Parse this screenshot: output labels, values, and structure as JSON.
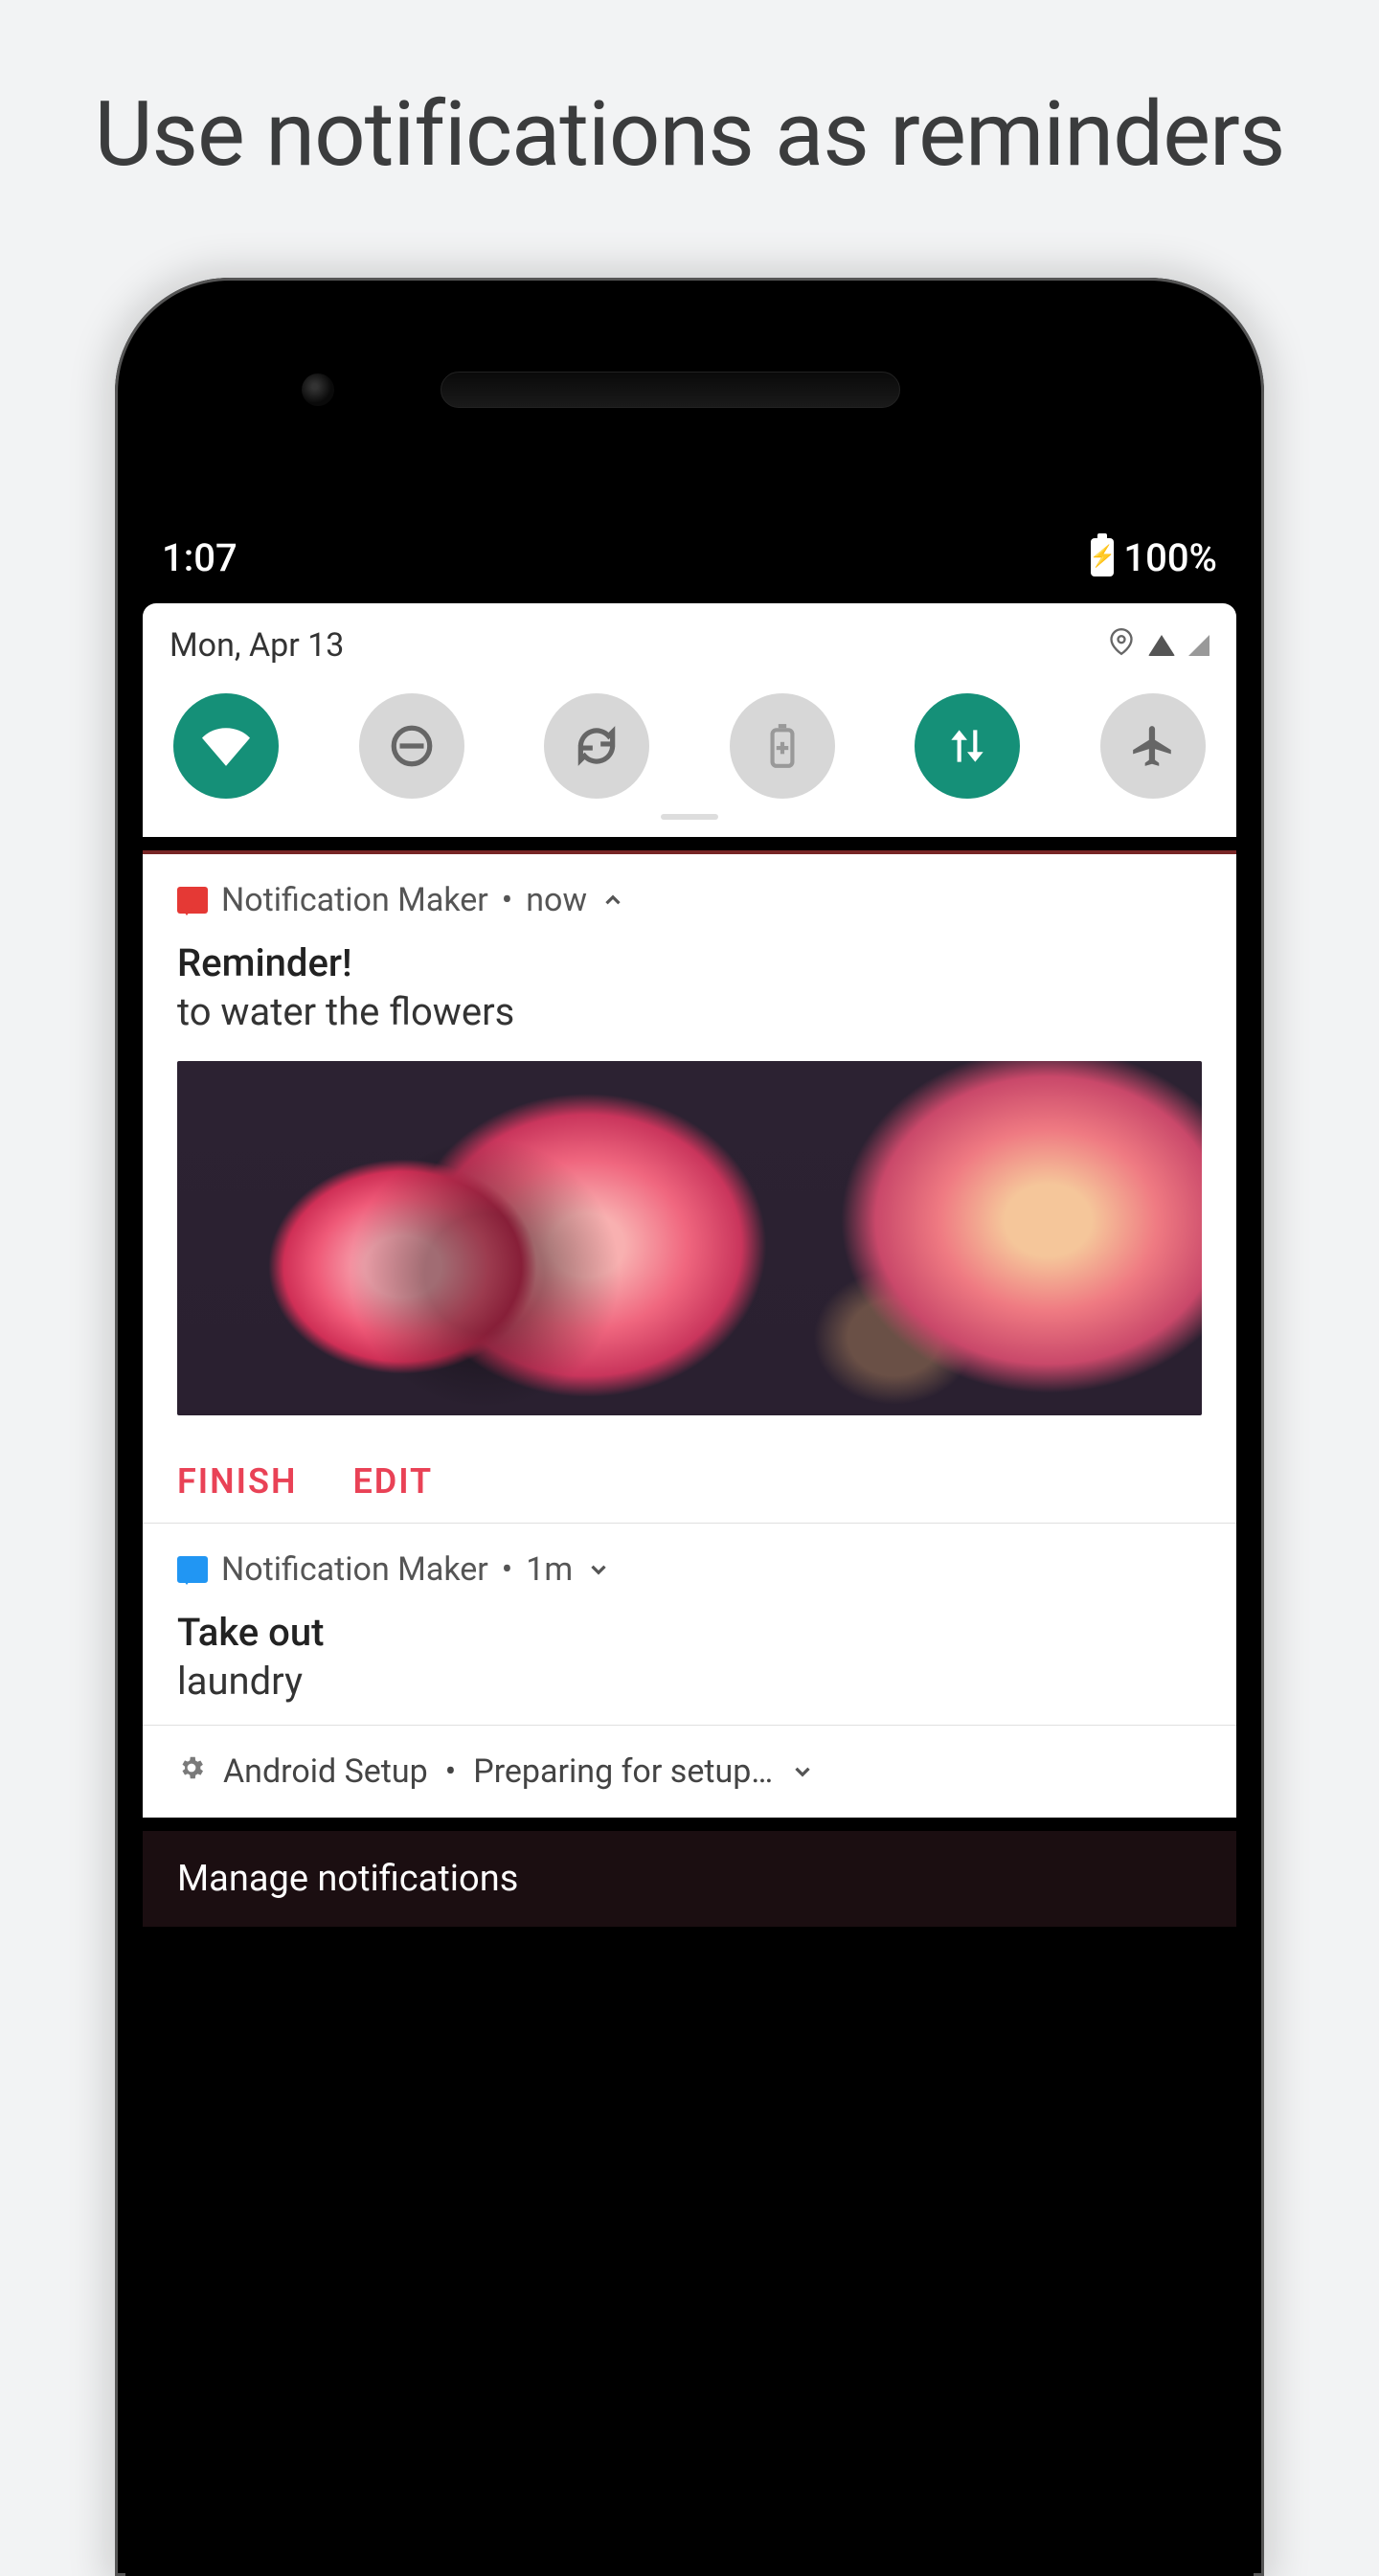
{
  "headline": "Use notifications as reminders",
  "status": {
    "time": "1:07",
    "battery": "100%"
  },
  "qs": {
    "date": "Mon, Apr 13",
    "toggles": [
      {
        "name": "wifi",
        "on": true
      },
      {
        "name": "do-not-disturb",
        "on": false
      },
      {
        "name": "auto-rotate",
        "on": false
      },
      {
        "name": "battery-saver",
        "on": false
      },
      {
        "name": "mobile-data",
        "on": true
      },
      {
        "name": "airplane-mode",
        "on": false
      }
    ]
  },
  "notifications": [
    {
      "app": "Notification Maker",
      "time": "now",
      "expanded": true,
      "title": "Reminder!",
      "body": "to water the flowers",
      "actions": [
        "FINISH",
        "EDIT"
      ],
      "icon_color": "red"
    },
    {
      "app": "Notification Maker",
      "time": "1m",
      "expanded": false,
      "title": "Take out",
      "body": "laundry",
      "icon_color": "blue"
    }
  ],
  "system_row": {
    "app": "Android Setup",
    "summary": "Preparing for setup…"
  },
  "manage_label": "Manage notifications"
}
